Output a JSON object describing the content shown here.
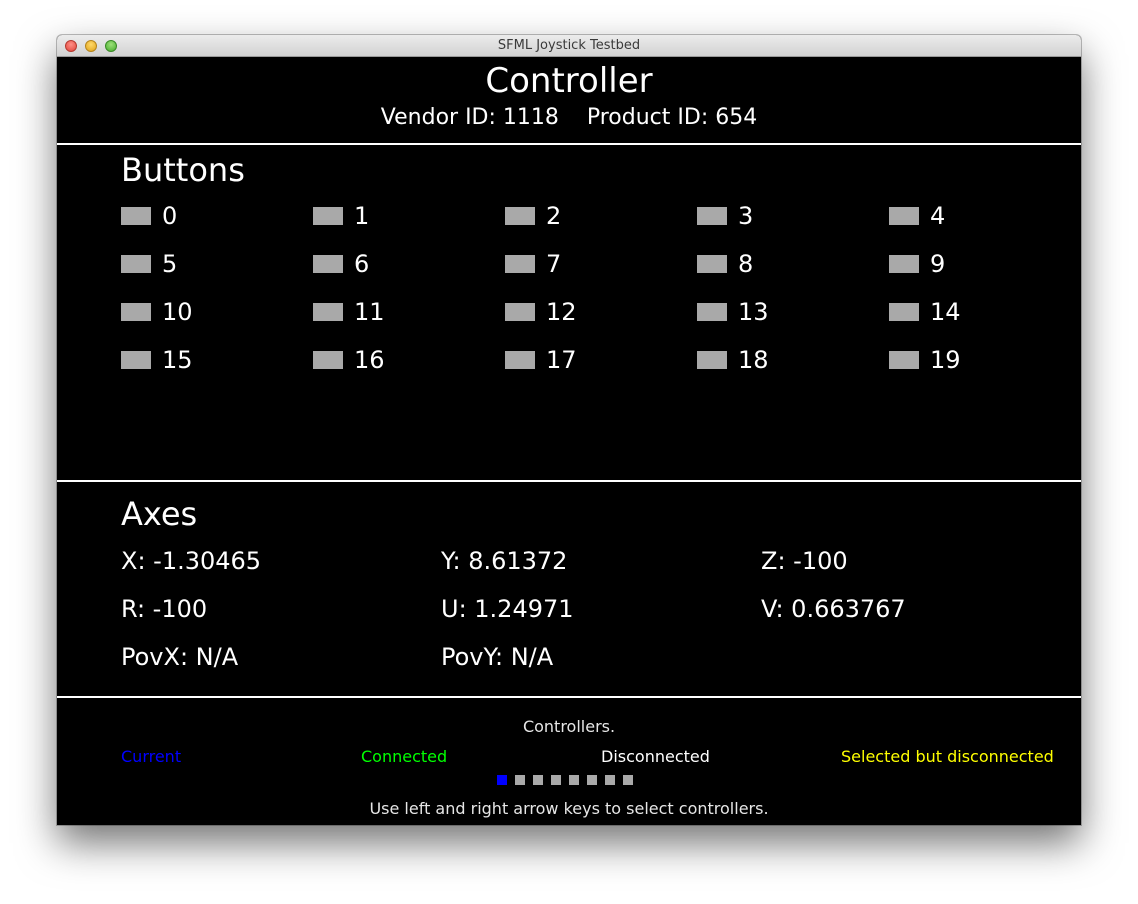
{
  "window": {
    "title": "SFML Joystick Testbed"
  },
  "header": {
    "title": "Controller",
    "ids": "Vendor ID: 1118    Product ID: 654"
  },
  "buttons": {
    "title": "Buttons",
    "items": [
      "0",
      "1",
      "2",
      "3",
      "4",
      "5",
      "6",
      "7",
      "8",
      "9",
      "10",
      "11",
      "12",
      "13",
      "14",
      "15",
      "16",
      "17",
      "18",
      "19"
    ]
  },
  "axes": {
    "title": "Axes",
    "items": [
      "X: -1.30465",
      "Y: 8.61372",
      "Z: -100",
      "R: -100",
      "U: 1.24971",
      "V: 0.663767",
      "PovX: N/A",
      "PovY: N/A"
    ]
  },
  "controllers": {
    "title": "Controllers.",
    "legend": [
      {
        "label": "Current",
        "color": "#0000ff"
      },
      {
        "label": "Connected",
        "color": "#00ff00"
      },
      {
        "label": "Disconnected",
        "color": "#ffffff"
      },
      {
        "label": "Selected but disconnected",
        "color": "#ffff00"
      }
    ],
    "slots": [
      "current",
      "disconnected",
      "disconnected",
      "disconnected",
      "disconnected",
      "disconnected",
      "disconnected",
      "disconnected"
    ],
    "hint": "Use left and right arrow keys to select controllers."
  },
  "colors": {
    "current": "#0000ff",
    "disconnected": "#a9a9a9",
    "button_idle": "#a9a9a9"
  }
}
